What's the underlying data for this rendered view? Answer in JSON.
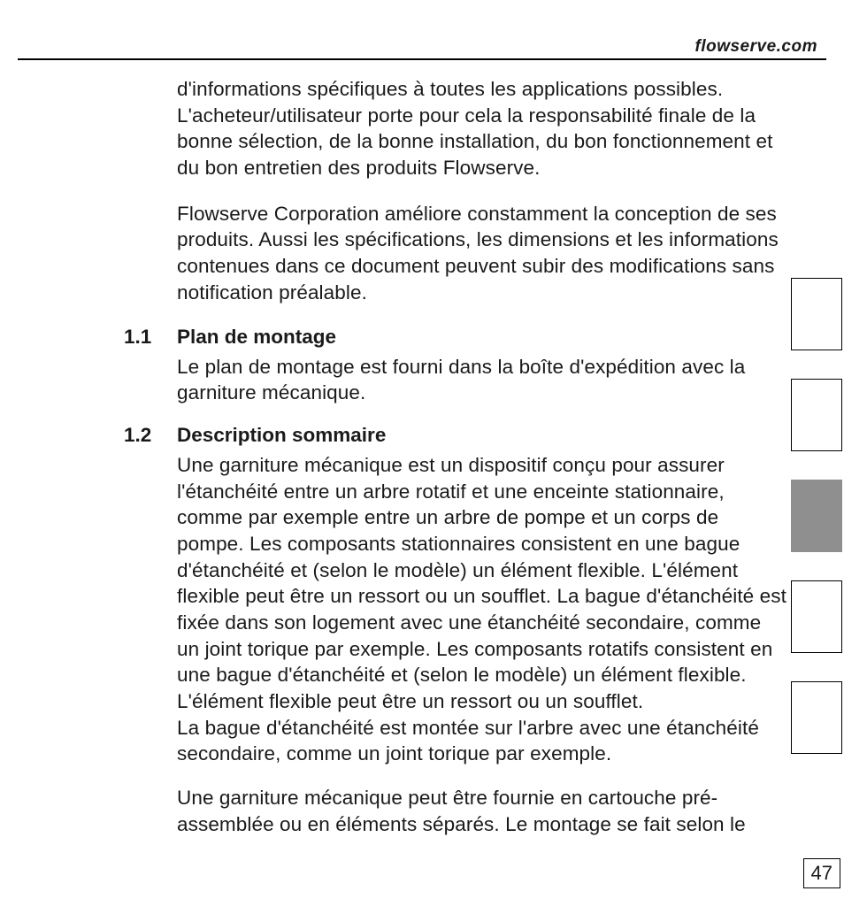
{
  "header": {
    "site": "flowserve.com"
  },
  "intro": {
    "p1": "d'informations spécifiques à toutes les applications possibles. L'acheteur/utilisateur porte pour cela la responsabilité finale de la bonne sélection, de la bonne installation, du bon fonctionnement et du bon entretien des produits Flowserve.",
    "p2": "Flowserve Corporation améliore constamment la conception de ses produits. Aussi les spécifications, les dimensions et les informations contenues dans ce document peuvent subir des modifications sans notification préalable."
  },
  "sections": [
    {
      "num": "1.1",
      "title": "Plan de montage",
      "paras": [
        "Le plan de montage est fourni dans la boîte d'expédition avec la garniture mécanique."
      ]
    },
    {
      "num": "1.2",
      "title": "Description sommaire",
      "paras": [
        "Une garniture mécanique est un dispositif conçu pour assurer l'étanchéité entre un arbre rotatif et une enceinte stationnaire, comme par exemple entre un arbre de pompe et un corps de pompe. Les composants stationnaires consistent en une bague d'étanchéité et (selon le modèle) un élément flexible. L'élément flexible peut être un ressort ou un soufflet. La bague d'étanchéité est fixée dans son logement avec une étanchéité secondaire, comme un joint torique par exemple. Les composants rotatifs consistent en une bague d'étanchéité et (selon le modèle) un élément flexible. L'élément flexible peut être un ressort ou un soufflet.",
        "La bague d'étanchéité est montée sur l'arbre avec une étanchéité secondaire, comme un joint torique par exemple.",
        "Une garniture mécanique peut être fournie en cartouche pré-assemblée ou en éléments séparés. Le montage se fait selon le"
      ]
    }
  ],
  "tabs": [
    {
      "active": false
    },
    {
      "active": false
    },
    {
      "active": true
    },
    {
      "active": false
    },
    {
      "active": false
    }
  ],
  "page_number": "47"
}
